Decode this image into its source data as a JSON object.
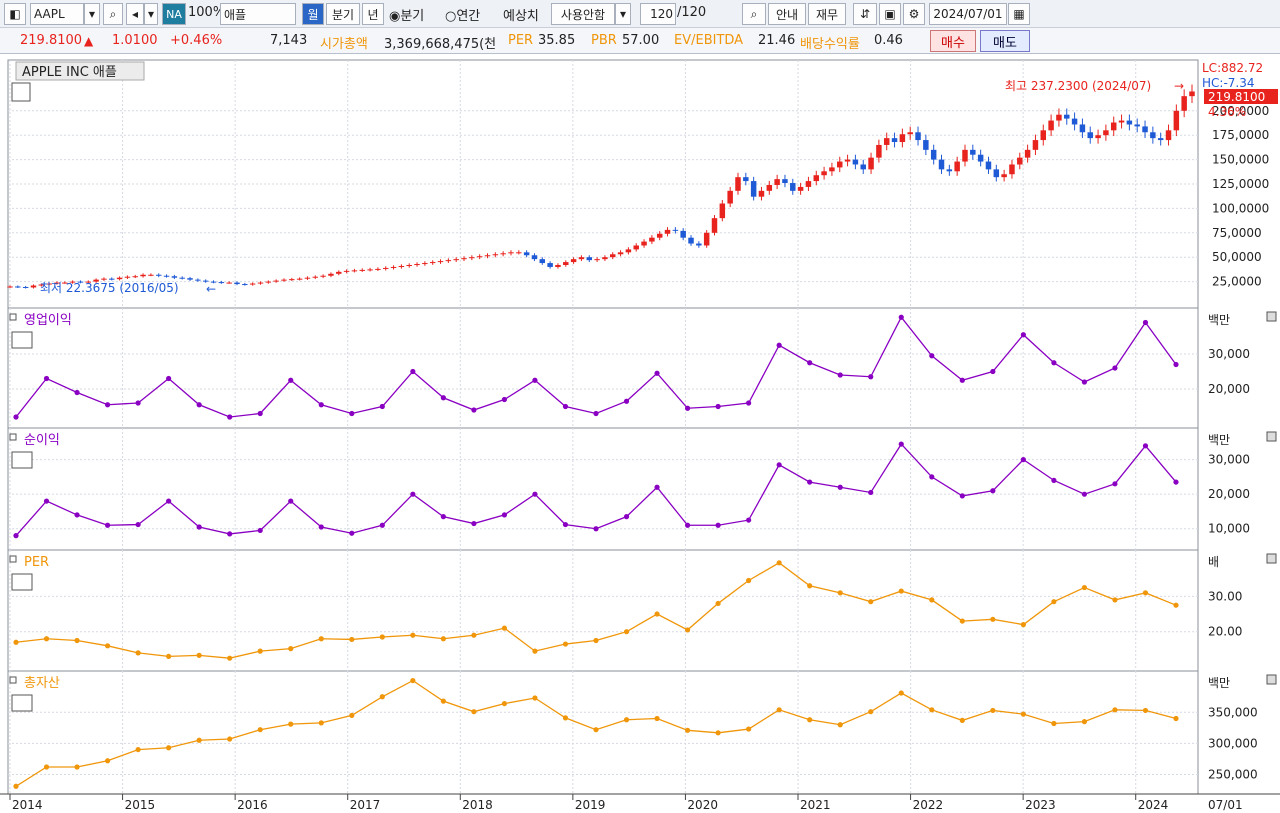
{
  "toolbar": {
    "ticker": "AAPL",
    "na_badge": "NA",
    "zoom": "100%",
    "name": "애플",
    "period_month": "월",
    "period_quarter": "분기",
    "period_year": "년",
    "radio_quarter": "분기",
    "radio_annual": "연간",
    "estimate_label": "예상치",
    "estimate_value": "사용안함",
    "count_current": "120",
    "count_total": "/120",
    "guide": "안내",
    "finance": "재무",
    "date": "2024/07/01"
  },
  "quote": {
    "price": "219.8100",
    "change_arrow": "▲",
    "change": "1.0100",
    "change_pct": "+0.46%",
    "volume": "7,143",
    "market_cap_label": "시가총액",
    "market_cap": "3,369,668,475(천",
    "per_label": "PER",
    "per": "35.85",
    "pbr_label": "PBR",
    "pbr": "57.00",
    "ev_label": "EV/EBITDA",
    "ev": "21.46",
    "div_label": "배당수익률",
    "div": "0.46",
    "buy": "매수",
    "sell": "매도"
  },
  "colors": {
    "up": "#e8231e",
    "down": "#1f5ad6",
    "purple": "#8a00c2",
    "orange": "#f0960a",
    "grid": "#d6dae2"
  },
  "chart_data": [
    {
      "type": "candlestick",
      "title": "APPLE INC 애플",
      "unit": "",
      "ylim": [
        0,
        250
      ],
      "ticks": [
        "25,0000",
        "50,0000",
        "75,0000",
        "100,0000",
        "125,0000",
        "150,0000",
        "175,0000",
        "200,0000"
      ],
      "tick_values": [
        25,
        50,
        75,
        100,
        125,
        150,
        175,
        200
      ],
      "x_start": "2014/01",
      "x_end": "2024/07",
      "lc_label": "LC:882.72",
      "hc_label": "HC:-7.34",
      "high_annotation": "최고 237.2300 (2024/07)",
      "low_annotation": "최저 22.3675 (2016/05)",
      "last_price_label": "219.8100",
      "last_pct_label": "4.36%",
      "closes": [
        20,
        19.5,
        19,
        21,
        22,
        23,
        24,
        24,
        25,
        24.5,
        25,
        27,
        28,
        27.5,
        29,
        30,
        30.5,
        32,
        32,
        31,
        30.5,
        29,
        28.5,
        27,
        26,
        25,
        24.5,
        24,
        24,
        22.5,
        22,
        23,
        24,
        25,
        26,
        27,
        27.5,
        28,
        29,
        30,
        31,
        33,
        35,
        36,
        36.5,
        37,
        37.5,
        38,
        39,
        40,
        41,
        42,
        43,
        44,
        45,
        46,
        47,
        48,
        49,
        50,
        51,
        52,
        53,
        54,
        55,
        55,
        52,
        48,
        44,
        40,
        42,
        45,
        48,
        50,
        47,
        48,
        50,
        53,
        55,
        58,
        62,
        66,
        70,
        74,
        78,
        77,
        70,
        64,
        62,
        75,
        90,
        105,
        118,
        132,
        128,
        112,
        118,
        124,
        130,
        126,
        118,
        122,
        128,
        134,
        138,
        142,
        148,
        150,
        145,
        140,
        152,
        165,
        172,
        168,
        176,
        178,
        170,
        160,
        150,
        140,
        138,
        148,
        160,
        155,
        148,
        140,
        132,
        135,
        145,
        152,
        160,
        170,
        180,
        190,
        196,
        192,
        186,
        178,
        172,
        175,
        180,
        188,
        190,
        186,
        184,
        178,
        172,
        170,
        180,
        200,
        215,
        219.81
      ],
      "annotations": [
        "→",
        "←"
      ]
    },
    {
      "type": "line",
      "title": "영업이익",
      "unit": "백만",
      "ylim": [
        10000,
        42000
      ],
      "ticks": [
        "20,000",
        "30,000"
      ],
      "tick_values": [
        20000,
        30000
      ],
      "values": [
        12000,
        23000,
        19000,
        15500,
        16000,
        23000,
        15500,
        12000,
        13000,
        22500,
        15500,
        13000,
        15000,
        25000,
        17500,
        14000,
        17000,
        22500,
        15000,
        13000,
        16500,
        24500,
        14500,
        15000,
        16000,
        32500,
        27500,
        24000,
        23500,
        40500,
        29500,
        22500,
        25000,
        35500,
        27500,
        22000,
        26000,
        39000,
        27000
      ]
    },
    {
      "type": "line",
      "title": "순이익",
      "unit": "백만",
      "ylim": [
        5000,
        38000
      ],
      "ticks": [
        "10,000",
        "20,000",
        "30,000"
      ],
      "tick_values": [
        10000,
        20000,
        30000
      ],
      "values": [
        8000,
        18000,
        14000,
        11000,
        11200,
        18000,
        10500,
        8500,
        9500,
        18000,
        10500,
        8700,
        11000,
        20000,
        13500,
        11500,
        14000,
        20000,
        11200,
        10000,
        13500,
        22000,
        11000,
        11000,
        12500,
        28500,
        23500,
        22000,
        20500,
        34500,
        25000,
        19500,
        21000,
        30000,
        24000,
        20000,
        23000,
        34000,
        23500
      ]
    },
    {
      "type": "line",
      "title": "PER",
      "unit": "배",
      "ylim": [
        10,
        42
      ],
      "ticks": [
        "20.00",
        "30.00"
      ],
      "tick_values": [
        20,
        30
      ],
      "values": [
        17,
        18,
        17.5,
        16,
        14,
        13,
        13.3,
        12.5,
        14.5,
        15.2,
        18,
        17.8,
        18.5,
        19,
        18,
        19,
        21,
        14.5,
        16.5,
        17.5,
        20,
        25,
        20.5,
        28,
        34.5,
        39.5,
        33,
        31,
        28.5,
        31.5,
        29,
        23,
        23.5,
        22,
        28.5,
        32.5,
        29,
        31,
        27.5
      ]
    },
    {
      "type": "line",
      "title": "총자산",
      "unit": "백만",
      "ylim": [
        225000,
        410000
      ],
      "ticks": [
        "250,000",
        "300,000",
        "350,000"
      ],
      "tick_values": [
        250000,
        300000,
        350000
      ],
      "values": [
        231000,
        262000,
        262000,
        272000,
        290000,
        293000,
        305000,
        307000,
        322000,
        331000,
        333000,
        345000,
        375000,
        401000,
        368000,
        351000,
        364000,
        373000,
        341000,
        322000,
        338000,
        340000,
        321000,
        317000,
        323000,
        354000,
        338000,
        330000,
        351000,
        381000,
        354000,
        337000,
        353000,
        347000,
        332000,
        335000,
        354000,
        353000,
        340000
      ]
    }
  ],
  "x_axis": {
    "labels": [
      "2014",
      "2015",
      "2016",
      "2017",
      "2018",
      "2019",
      "2020",
      "2021",
      "2022",
      "2023",
      "2024"
    ],
    "right_label": "07/01"
  }
}
